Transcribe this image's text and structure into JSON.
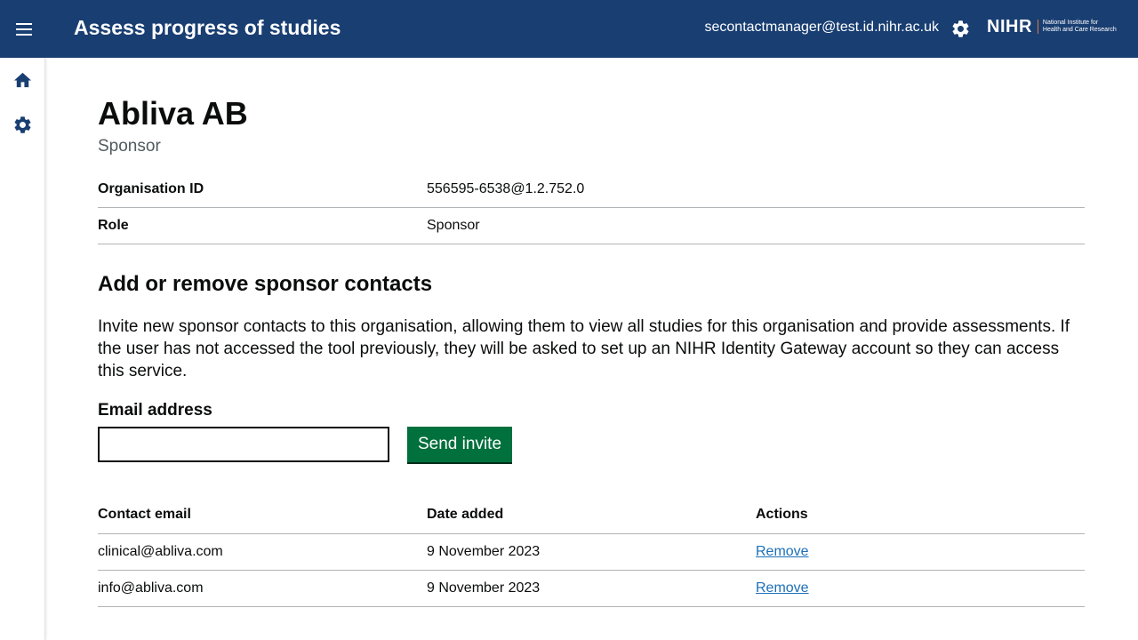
{
  "header": {
    "app_title": "Assess progress of studies",
    "user_email": "secontactmanager@test.id.nihr.ac.uk",
    "logo_main": "NIHR",
    "logo_sub_line1": "National Institute for",
    "logo_sub_line2": "Health and Care Research",
    "icons": {
      "menu": "menu-icon",
      "settings": "gear-icon"
    }
  },
  "sidebar": {
    "items": [
      {
        "name": "home",
        "icon": "home-icon"
      },
      {
        "name": "settings",
        "icon": "gear-icon"
      }
    ]
  },
  "page": {
    "title": "Abliva AB",
    "caption": "Sponsor",
    "summary": [
      {
        "key": "Organisation ID",
        "value": "556595-6538@1.2.752.0"
      },
      {
        "key": "Role",
        "value": "Sponsor"
      }
    ],
    "section_heading": "Add or remove sponsor contacts",
    "description": "Invite new sponsor contacts to this organisation, allowing them to view all studies for this organisation and provide assessments. If the user has not accessed the tool previously, they will be asked to set up an NIHR Identity Gateway account so they can access this service.",
    "form": {
      "email_label": "Email address",
      "email_value": "",
      "send_button": "Send invite"
    },
    "contacts_table": {
      "headers": [
        "Contact email",
        "Date added",
        "Actions"
      ],
      "rows": [
        {
          "email": "clinical@abliva.com",
          "date": "9 November 2023",
          "action": "Remove"
        },
        {
          "email": "info@abliva.com",
          "date": "9 November 2023",
          "action": "Remove"
        }
      ]
    }
  },
  "colors": {
    "header_bg": "#193e72",
    "button_green": "#00703c",
    "link_blue": "#1d70b8",
    "logo_accent": "#e27a2e"
  }
}
